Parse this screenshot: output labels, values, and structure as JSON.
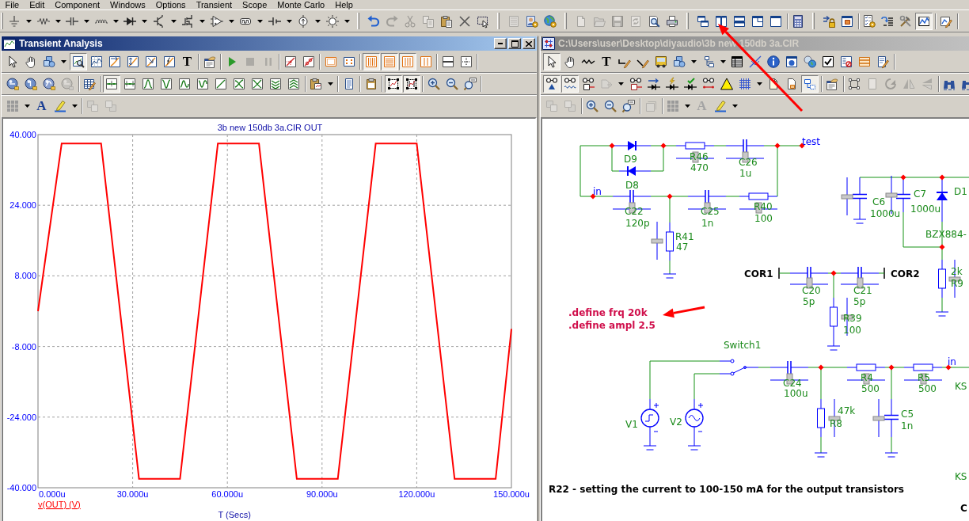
{
  "menu_bar": [
    "File",
    "Edit",
    "Component",
    "Windows",
    "Options",
    "Transient",
    "Scope",
    "Monte Carlo",
    "Help"
  ],
  "main_toolbar": [
    {
      "pressed": false,
      "disabled": false
    },
    {
      "pressed": false,
      "disabled": false
    },
    {
      "pressed": false,
      "disabled": false
    },
    {
      "pressed": false,
      "disabled": false
    },
    {
      "pressed": false,
      "disabled": false
    },
    {
      "pressed": false,
      "disabled": false
    },
    {
      "pressed": false,
      "disabled": false
    },
    {
      "pressed": false,
      "disabled": false
    },
    {
      "pressed": false,
      "disabled": false
    },
    {
      "pressed": false,
      "disabled": false
    },
    {
      "pressed": false,
      "disabled": false
    },
    {
      "pressed": false,
      "disabled": false
    },
    {
      "pressed": false,
      "disabled": false
    },
    {
      "pressed": false,
      "disabled": true
    },
    {
      "pressed": false,
      "disabled": true
    },
    {
      "pressed": false,
      "disabled": true
    },
    {
      "pressed": false,
      "disabled": false
    },
    {
      "pressed": false,
      "disabled": false
    },
    {
      "pressed": false,
      "disabled": false
    },
    {
      "pressed": false,
      "disabled": true
    },
    {
      "pressed": false,
      "disabled": false
    },
    {
      "pressed": false,
      "disabled": false
    },
    {
      "pressed": false,
      "disabled": true
    },
    {
      "pressed": false,
      "disabled": true
    },
    {
      "pressed": false,
      "disabled": true
    },
    {
      "pressed": false,
      "disabled": true
    },
    {
      "pressed": false,
      "disabled": false
    },
    {
      "pressed": false,
      "disabled": false
    },
    {
      "pressed": false,
      "disabled": false
    },
    {
      "pressed": false,
      "disabled": false
    },
    {
      "pressed": false,
      "disabled": false
    },
    {
      "pressed": false,
      "disabled": false
    },
    {
      "pressed": false,
      "disabled": false
    },
    {
      "pressed": false,
      "disabled": false
    },
    {
      "pressed": false,
      "disabled": false
    },
    {
      "pressed": false,
      "disabled": false
    },
    {
      "pressed": false,
      "disabled": false
    },
    {
      "pressed": false,
      "disabled": false
    },
    {
      "pressed": false,
      "disabled": false
    },
    {
      "pressed": true,
      "disabled": false
    },
    {
      "pressed": false,
      "disabled": false
    }
  ],
  "transient_window": {
    "title": "Transient Analysis",
    "active": true,
    "controls": [
      {
        "kind": "minimize"
      },
      {
        "kind": "maximize"
      },
      {
        "kind": "close"
      }
    ],
    "toolbar_rows": [
      [
        {
          "pressed": false,
          "disabled": false
        },
        {
          "pressed": false,
          "disabled": false
        },
        {
          "pressed": false,
          "disabled": false
        },
        {
          "pressed": true,
          "disabled": false
        },
        {
          "pressed": false,
          "disabled": false
        },
        {
          "pressed": false,
          "disabled": false
        },
        {
          "pressed": false,
          "disabled": false
        },
        {
          "pressed": false,
          "disabled": false
        },
        {
          "pressed": false,
          "disabled": false
        },
        {
          "glyph": "T",
          "pressed": false,
          "disabled": false
        },
        {
          "pressed": false,
          "disabled": false
        },
        {
          "pressed": false,
          "disabled": false
        },
        {
          "pressed": false,
          "disabled": true
        },
        {
          "pressed": false,
          "disabled": true
        },
        {
          "pressed": false,
          "disabled": false
        },
        {
          "pressed": false,
          "disabled": false
        },
        {
          "pressed": false,
          "disabled": false
        },
        {
          "pressed": false,
          "disabled": false
        },
        {
          "pressed": true,
          "disabled": false
        },
        {
          "pressed": true,
          "disabled": false
        },
        {
          "pressed": true,
          "disabled": false
        },
        {
          "pressed": false,
          "disabled": false
        },
        {
          "pressed": false,
          "disabled": false
        },
        {
          "pressed": false,
          "disabled": false
        }
      ],
      [
        {
          "pressed": false,
          "disabled": false
        },
        {
          "pressed": false,
          "disabled": false
        },
        {
          "pressed": false,
          "disabled": false
        },
        {
          "pressed": false,
          "disabled": true
        },
        {
          "pressed": false,
          "disabled": false
        },
        {
          "pressed": true,
          "disabled": false
        },
        {
          "pressed": false,
          "disabled": false
        },
        {
          "pressed": false,
          "disabled": false
        },
        {
          "pressed": false,
          "disabled": false
        },
        {
          "pressed": false,
          "disabled": false
        },
        {
          "pressed": false,
          "disabled": false
        },
        {
          "pressed": false,
          "disabled": false
        },
        {
          "pressed": false,
          "disabled": false
        },
        {
          "pressed": false,
          "disabled": false
        },
        {
          "pressed": false,
          "disabled": false
        },
        {
          "pressed": false,
          "disabled": false
        },
        {
          "pressed": false,
          "disabled": false
        },
        {
          "pressed": false,
          "disabled": false
        },
        {
          "pressed": false,
          "disabled": false
        },
        {
          "pressed": true,
          "disabled": false
        },
        {
          "pressed": true,
          "disabled": false
        },
        {
          "pressed": false,
          "disabled": false
        },
        {
          "pressed": false,
          "disabled": false
        },
        {
          "pressed": false,
          "disabled": false
        }
      ],
      [
        {
          "pressed": false,
          "disabled": false
        },
        {
          "glyph": "A",
          "pressed": false,
          "disabled": false
        },
        {
          "pressed": false,
          "disabled": false
        },
        {
          "pressed": false,
          "disabled": true
        },
        {
          "pressed": false,
          "disabled": true
        }
      ]
    ],
    "plot": {
      "chart_data": {
        "type": "line",
        "title": "3b new 150db 3a.CIR OUT",
        "xlabel": "T (Secs)",
        "x": [
          0,
          7.5,
          20,
          32,
          45,
          57,
          70,
          82,
          95,
          107,
          120,
          132,
          145,
          150
        ],
        "series": [
          {
            "name": "v(OUT) (V)",
            "color": "#ff0000",
            "values": [
              0,
              38,
              38,
              -38,
              -38,
              38,
              38,
              -38,
              -38,
              38,
              38,
              -38,
              -38,
              -4
            ]
          }
        ],
        "xlim": [
          0,
          150
        ],
        "ylim": [
          -40,
          40
        ],
        "xticks": [
          {
            "value": 0,
            "label": "0.000u"
          },
          {
            "value": 30,
            "label": "30.000u"
          },
          {
            "value": 60,
            "label": "60.000u"
          },
          {
            "value": 90,
            "label": "90.000u"
          },
          {
            "value": 120,
            "label": "120.000u"
          },
          {
            "value": 150,
            "label": "150.000u"
          }
        ],
        "yticks": [
          {
            "value": 40,
            "label": "40.000"
          },
          {
            "value": 24,
            "label": "24.000"
          },
          {
            "value": 8,
            "label": "8.000"
          },
          {
            "value": -8,
            "label": "-8.000"
          },
          {
            "value": -24,
            "label": "-24.000"
          },
          {
            "value": -40,
            "label": "-40.000"
          }
        ],
        "grid": true
      }
    }
  },
  "schematic_window": {
    "title": "C:\\Users\\user\\Desktop\\diyaudio\\3b new 150db 3a.CIR",
    "active": false,
    "toolbar_rows": [
      [
        {
          "pressed": true,
          "disabled": false
        },
        {
          "pressed": false,
          "disabled": false
        },
        {
          "pressed": false,
          "disabled": false
        },
        {
          "glyph": "T",
          "pressed": false,
          "disabled": false
        },
        {
          "pressed": false,
          "disabled": false
        },
        {
          "pressed": false,
          "disabled": false
        },
        {
          "pressed": false,
          "disabled": false
        },
        {
          "pressed": false,
          "disabled": false
        },
        {
          "pressed": false,
          "disabled": false
        },
        {
          "pressed": false,
          "disabled": false
        },
        {
          "pressed": false,
          "disabled": false
        },
        {
          "pressed": false,
          "disabled": false
        },
        {
          "pressed": false,
          "disabled": false
        },
        {
          "pressed": false,
          "disabled": false
        },
        {
          "pressed": false,
          "disabled": false
        },
        {
          "pressed": false,
          "disabled": false
        },
        {
          "pressed": false,
          "disabled": false
        },
        {
          "pressed": false,
          "disabled": false
        }
      ],
      [
        {
          "pressed": true,
          "disabled": false
        },
        {
          "pressed": true,
          "disabled": false
        },
        {
          "pressed": false,
          "disabled": false
        },
        {
          "pressed": false,
          "disabled": true
        },
        {
          "pressed": false,
          "disabled": false
        },
        {
          "pressed": false,
          "disabled": false
        },
        {
          "pressed": false,
          "disabled": false
        },
        {
          "pressed": false,
          "disabled": false
        },
        {
          "pressed": false,
          "disabled": false
        },
        {
          "pressed": false,
          "disabled": false
        },
        {
          "pressed": false,
          "disabled": false
        },
        {
          "pressed": false,
          "disabled": false
        },
        {
          "pressed": false,
          "disabled": false
        },
        {
          "pressed": true,
          "disabled": false
        },
        {
          "pressed": false,
          "disabled": false
        },
        {
          "pressed": false,
          "disabled": false
        },
        {
          "pressed": false,
          "disabled": true
        },
        {
          "pressed": false,
          "disabled": true
        },
        {
          "pressed": false,
          "disabled": true
        },
        {
          "pressed": false,
          "disabled": true
        },
        {
          "pressed": false,
          "disabled": false
        },
        {
          "pressed": false,
          "disabled": false
        }
      ],
      [
        {
          "pressed": false,
          "disabled": true
        },
        {
          "pressed": false,
          "disabled": true
        },
        {
          "pressed": false,
          "disabled": false
        },
        {
          "pressed": false,
          "disabled": false
        },
        {
          "pressed": false,
          "disabled": false
        },
        {
          "pressed": false,
          "disabled": true
        },
        {
          "pressed": false,
          "disabled": false
        },
        {
          "glyph": "A",
          "pressed": false,
          "disabled": true
        },
        {
          "pressed": false,
          "disabled": false
        }
      ]
    ],
    "schematic": {
      "net_labels": [
        "test",
        "in",
        "in"
      ],
      "components": [
        {
          "ref": "D9"
        },
        {
          "ref": "D8"
        },
        {
          "ref": "R46",
          "value": "470"
        },
        {
          "ref": "C26",
          "value": "1u"
        },
        {
          "ref": "C22",
          "value": "120p"
        },
        {
          "ref": "C25",
          "value": "1n"
        },
        {
          "ref": "R40",
          "value": "100"
        },
        {
          "ref": "R41",
          "value": "47"
        },
        {
          "ref": "C6",
          "value": "1000u"
        },
        {
          "ref": "C7",
          "value": "1000u"
        },
        {
          "ref": "D1",
          "value": "BZX884-"
        },
        {
          "ref": "R9",
          "value": "2k"
        },
        {
          "ref": "C20",
          "value": "5p"
        },
        {
          "ref": "C21",
          "value": "5p"
        },
        {
          "ref": "R39",
          "value": "100"
        },
        {
          "ref": "Switch1"
        },
        {
          "ref": "C24",
          "value": "100u"
        },
        {
          "ref": "R4",
          "value": "500"
        },
        {
          "ref": "R5",
          "value": "500"
        },
        {
          "ref": "KS"
        },
        {
          "ref": "V1"
        },
        {
          "ref": "V2"
        },
        {
          "ref": "R8",
          "value": "47k"
        },
        {
          "ref": "C5",
          "value": "1n"
        },
        {
          "ref": "KS"
        }
      ],
      "ports": [
        "COR1",
        "COR2"
      ],
      "directives": [
        ".define frq 20k",
        ".define ampl 2.5"
      ],
      "notes": [
        "R22 - setting the current to 100-150 mA for the output transistors",
        "C"
      ]
    }
  }
}
